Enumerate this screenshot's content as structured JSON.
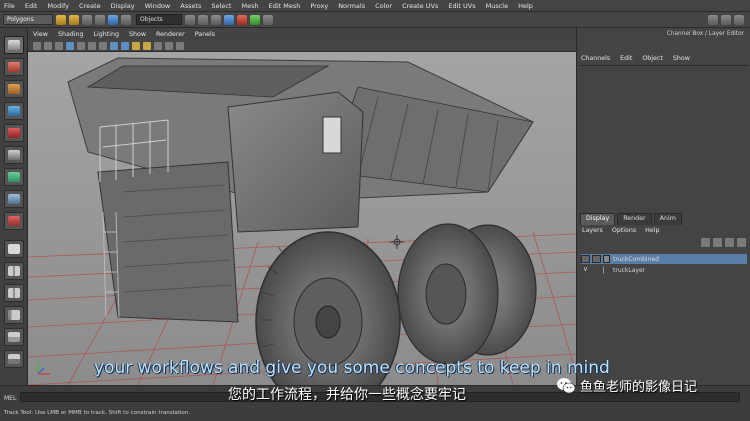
{
  "menubar": {
    "items": [
      "File",
      "Edit",
      "Modify",
      "Create",
      "Display",
      "Window",
      "Assets",
      "Select",
      "Mesh",
      "Edit Mesh",
      "Proxy",
      "Normals",
      "Color",
      "Create UVs",
      "Edit UVs",
      "Muscle",
      "Help"
    ]
  },
  "statusline": {
    "mode": "Polygons",
    "objects_field": "Objects"
  },
  "panel": {
    "menu": [
      "View",
      "Shading",
      "Lighting",
      "Show",
      "Renderer",
      "Panels"
    ]
  },
  "channel_box": {
    "title": "Channel Box / Layer Editor",
    "menu": [
      "Channels",
      "Edit",
      "Object",
      "Show"
    ]
  },
  "layer_editor": {
    "tabs": [
      "Display",
      "Render",
      "Anim"
    ],
    "active_tab": "Display",
    "menu": [
      "Layers",
      "Options",
      "Help"
    ],
    "layers": [
      {
        "visible": "",
        "name": "truckCombined",
        "selected": true
      },
      {
        "visible": "V",
        "name": "truckLayer",
        "selected": false
      }
    ]
  },
  "command_line": {
    "label": "MEL",
    "help_line": "Track Tool: Use LMB or MMB to track. Shift to constrain translation."
  },
  "subtitles": {
    "english": "your workflows and give you some concepts to keep in mind",
    "chinese": "您的工作流程，并给你一些概念要牢记"
  },
  "watermark": {
    "text": "鱼鱼老师的影像日记",
    "icon": "wechat-icon"
  },
  "colors": {
    "viewport_bg": "#9a9a9a",
    "grid_red": "#b44a4a",
    "selection": "#5a7fa6",
    "subtitle_en": "#b8e4ff"
  }
}
